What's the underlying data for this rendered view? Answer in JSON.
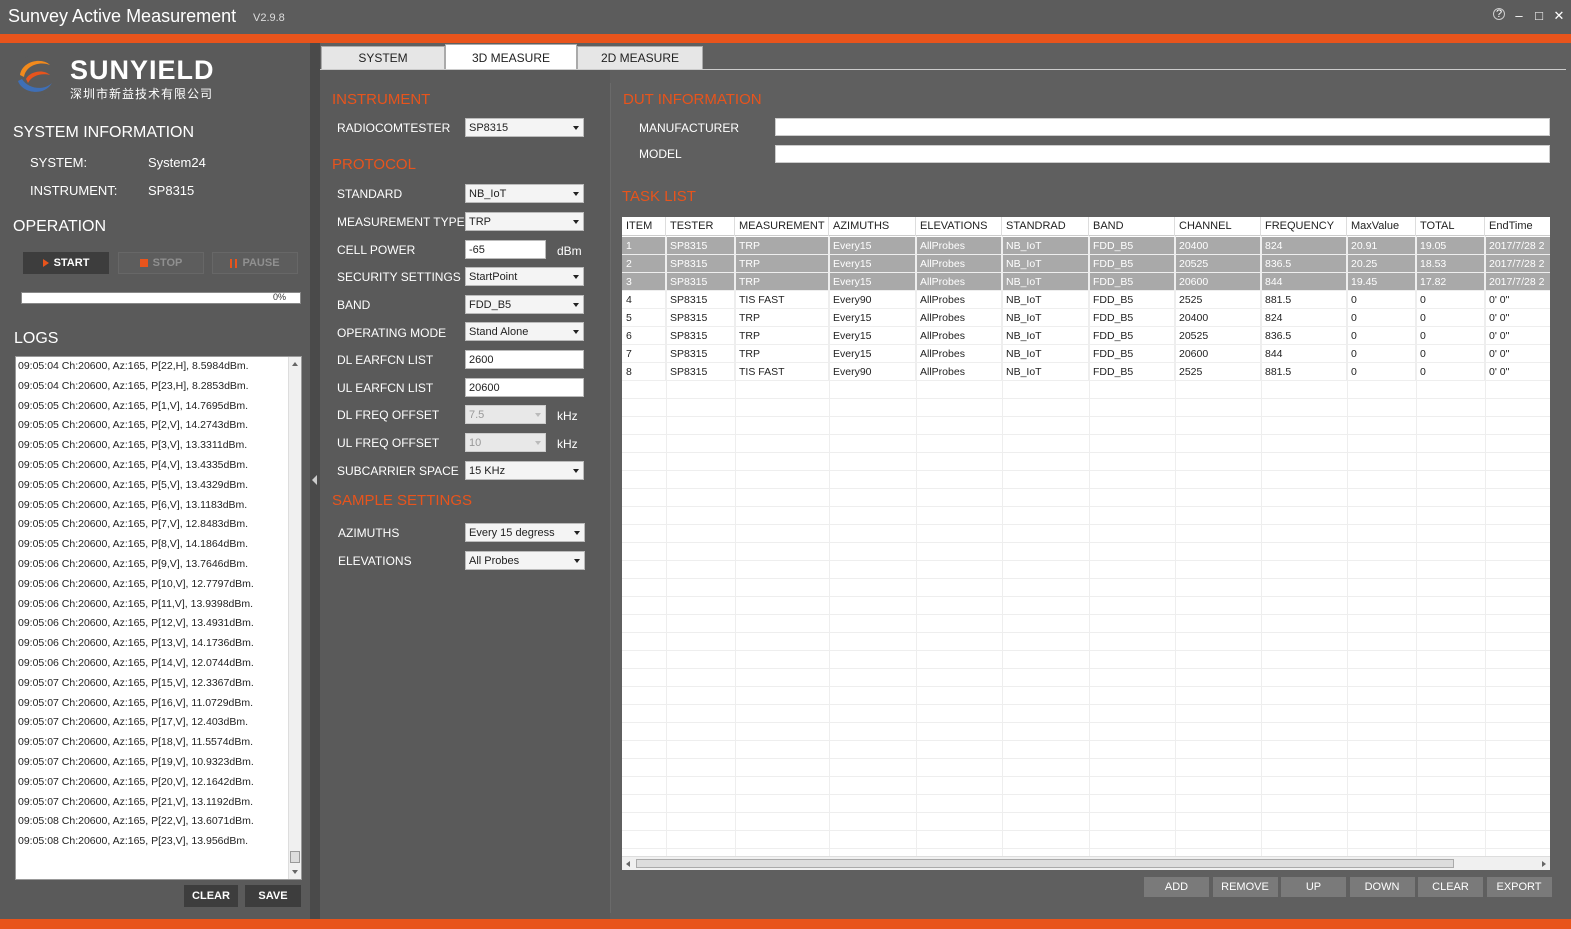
{
  "window": {
    "title": "Sunvey Active Measurement",
    "version": "V2.9.8",
    "controls": [
      "?",
      "–",
      "□",
      "✕"
    ]
  },
  "logo": {
    "brand": "SUNYIELD",
    "subtitle": "深圳市新益技术有限公司"
  },
  "system_info": {
    "heading": "SYSTEM INFORMATION",
    "system_label": "SYSTEM:",
    "system_value": "System24",
    "instrument_label": "INSTRUMENT:",
    "instrument_value": "SP8315"
  },
  "operation": {
    "heading": "OPERATION",
    "start": "START",
    "stop": "STOP",
    "pause": "PAUSE",
    "progress_percent": 0,
    "progress_text": "0%"
  },
  "logs": {
    "heading": "LOGS",
    "lines": [
      "09:05:04 Ch:20600, Az:165, P[22,H], 8.5984dBm.",
      "09:05:04 Ch:20600, Az:165, P[23,H], 8.2853dBm.",
      "09:05:05 Ch:20600, Az:165, P[1,V], 14.7695dBm.",
      "09:05:05 Ch:20600, Az:165, P[2,V], 14.2743dBm.",
      "09:05:05 Ch:20600, Az:165, P[3,V], 13.3311dBm.",
      "09:05:05 Ch:20600, Az:165, P[4,V], 13.4335dBm.",
      "09:05:05 Ch:20600, Az:165, P[5,V], 13.4329dBm.",
      "09:05:05 Ch:20600, Az:165, P[6,V], 13.1183dBm.",
      "09:05:05 Ch:20600, Az:165, P[7,V], 12.8483dBm.",
      "09:05:05 Ch:20600, Az:165, P[8,V], 14.1864dBm.",
      "09:05:06 Ch:20600, Az:165, P[9,V], 13.7646dBm.",
      "09:05:06 Ch:20600, Az:165, P[10,V], 12.7797dBm.",
      "09:05:06 Ch:20600, Az:165, P[11,V], 13.9398dBm.",
      "09:05:06 Ch:20600, Az:165, P[12,V], 13.4931dBm.",
      "09:05:06 Ch:20600, Az:165, P[13,V], 14.1736dBm.",
      "09:05:06 Ch:20600, Az:165, P[14,V], 12.0744dBm.",
      "09:05:07 Ch:20600, Az:165, P[15,V], 12.3367dBm.",
      "09:05:07 Ch:20600, Az:165, P[16,V], 11.0729dBm.",
      "09:05:07 Ch:20600, Az:165, P[17,V], 12.403dBm.",
      "09:05:07 Ch:20600, Az:165, P[18,V], 11.5574dBm.",
      "09:05:07 Ch:20600, Az:165, P[19,V], 10.9323dBm.",
      "09:05:07 Ch:20600, Az:165, P[20,V], 12.1642dBm.",
      "09:05:07 Ch:20600, Az:165, P[21,V], 13.1192dBm.",
      "09:05:08 Ch:20600, Az:165, P[22,V], 13.6071dBm.",
      "09:05:08 Ch:20600, Az:165, P[23,V], 13.956dBm."
    ],
    "clear": "CLEAR",
    "save": "SAVE"
  },
  "tabs": [
    {
      "label": "SYSTEM",
      "active": false
    },
    {
      "label": "3D MEASURE",
      "active": true
    },
    {
      "label": "2D MEASURE",
      "active": false
    }
  ],
  "instrument": {
    "heading": "INSTRUMENT",
    "radiocomtester_label": "RADIOCOMTESTER",
    "radiocomtester_value": "SP8315"
  },
  "protocol": {
    "heading": "PROTOCOL",
    "standard_label": "STANDARD",
    "standard_value": "NB_IoT",
    "measurement_type_label": "MEASUREMENT TYPE",
    "measurement_type_value": "TRP",
    "cell_power_label": "CELL POWER",
    "cell_power_value": "-65",
    "cell_power_unit": "dBm",
    "security_label": "SECURITY SETTINGS",
    "security_value": "StartPoint",
    "band_label": "BAND",
    "band_value": "FDD_B5",
    "operating_mode_label": "OPERATING MODE",
    "operating_mode_value": "Stand Alone",
    "dl_earfcn_label": "DL EARFCN LIST",
    "dl_earfcn_value": "2600",
    "ul_earfcn_label": "UL EARFCN LIST",
    "ul_earfcn_value": "20600",
    "dl_freq_offset_label": "DL FREQ OFFSET",
    "dl_freq_offset_value": "7.5",
    "dl_freq_offset_unit": "kHz",
    "ul_freq_offset_label": "UL FREQ OFFSET",
    "ul_freq_offset_value": "10",
    "ul_freq_offset_unit": "kHz",
    "subcarrier_label": "SUBCARRIER SPACE",
    "subcarrier_value": "15 KHz"
  },
  "sample": {
    "heading": "SAMPLE SETTINGS",
    "azimuths_label": "AZIMUTHS",
    "azimuths_value": "Every 15 degress",
    "elevations_label": "ELEVATIONS",
    "elevations_value": "All Probes"
  },
  "dut": {
    "heading": "DUT INFORMATION",
    "manufacturer_label": "MANUFACTURER",
    "manufacturer_value": "",
    "model_label": "MODEL",
    "model_value": ""
  },
  "task_list": {
    "heading": "TASK LIST",
    "columns": [
      "ITEM",
      "TESTER",
      "MEASUREMENT",
      "AZIMUTHS",
      "ELEVATIONS",
      "STANDRAD",
      "BAND",
      "CHANNEL",
      "FREQUENCY",
      "MaxValue",
      "TOTAL",
      "EndTime"
    ],
    "rows": [
      {
        "selected": true,
        "cells": [
          "1",
          "SP8315",
          "TRP",
          "Every15",
          "AllProbes",
          "NB_IoT",
          "FDD_B5",
          "20400",
          "824",
          "20.91",
          "19.05",
          "2017/7/28 2"
        ]
      },
      {
        "selected": true,
        "cells": [
          "2",
          "SP8315",
          "TRP",
          "Every15",
          "AllProbes",
          "NB_IoT",
          "FDD_B5",
          "20525",
          "836.5",
          "20.25",
          "18.53",
          "2017/7/28 2"
        ]
      },
      {
        "selected": true,
        "cells": [
          "3",
          "SP8315",
          "TRP",
          "Every15",
          "AllProbes",
          "NB_IoT",
          "FDD_B5",
          "20600",
          "844",
          "19.45",
          "17.82",
          "2017/7/28 2"
        ]
      },
      {
        "selected": false,
        "cells": [
          "4",
          "SP8315",
          "TIS FAST",
          "Every90",
          "AllProbes",
          "NB_IoT",
          "FDD_B5",
          "2525",
          "881.5",
          "0",
          "0",
          "0' 0\""
        ]
      },
      {
        "selected": false,
        "cells": [
          "5",
          "SP8315",
          "TRP",
          "Every15",
          "AllProbes",
          "NB_IoT",
          "FDD_B5",
          "20400",
          "824",
          "0",
          "0",
          "0' 0\""
        ]
      },
      {
        "selected": false,
        "cells": [
          "6",
          "SP8315",
          "TRP",
          "Every15",
          "AllProbes",
          "NB_IoT",
          "FDD_B5",
          "20525",
          "836.5",
          "0",
          "0",
          "0' 0\""
        ]
      },
      {
        "selected": false,
        "cells": [
          "7",
          "SP8315",
          "TRP",
          "Every15",
          "AllProbes",
          "NB_IoT",
          "FDD_B5",
          "20600",
          "844",
          "0",
          "0",
          "0' 0\""
        ]
      },
      {
        "selected": false,
        "cells": [
          "8",
          "SP8315",
          "TIS FAST",
          "Every90",
          "AllProbes",
          "NB_IoT",
          "FDD_B5",
          "2525",
          "881.5",
          "0",
          "0",
          "0' 0\""
        ]
      }
    ],
    "buttons": [
      "ADD",
      "REMOVE",
      "UP",
      "DOWN",
      "CLEAR",
      "EXPORT"
    ]
  },
  "colors": {
    "accent": "#e8541c",
    "background": "#5f5f5f",
    "selected_row": "#a9a9a9"
  }
}
